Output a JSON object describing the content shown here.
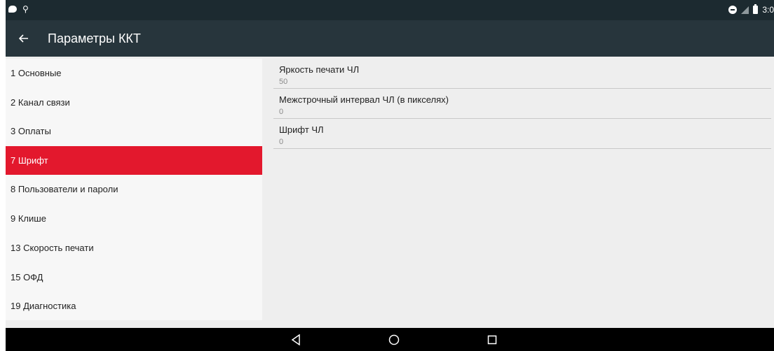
{
  "status_bar": {
    "time": "3:0",
    "icons": [
      "notification-icon",
      "usb-icon",
      "do-not-disturb-icon",
      "no-signal-icon",
      "battery-icon"
    ]
  },
  "toolbar": {
    "back_icon": "arrow-left-icon",
    "title": "Параметры ККТ"
  },
  "menu": {
    "items": [
      {
        "label": "1 Основные"
      },
      {
        "label": "2 Канал связи"
      },
      {
        "label": "3 Оплаты"
      },
      {
        "label": "7 Шрифт"
      },
      {
        "label": "8 Пользователи и пароли"
      },
      {
        "label": "9 Клише"
      },
      {
        "label": "13 Скорость печати"
      },
      {
        "label": "15 ОФД"
      },
      {
        "label": "19 Диагностика"
      }
    ],
    "selected": "7 Шрифт"
  },
  "settings": {
    "items": [
      {
        "title": "Яркость печати ЧЛ",
        "value": "50"
      },
      {
        "title": "Межстрочный интервал ЧЛ (в пикселях)",
        "value": "0"
      },
      {
        "title": "Шрифт ЧЛ",
        "value": "0"
      }
    ]
  },
  "navbar": {
    "icons": [
      "back-triangle-icon",
      "home-circle-icon",
      "recents-square-icon"
    ]
  },
  "colors": {
    "status_bar": "#1c2a30",
    "toolbar": "#27353c",
    "accent": "#e3182d",
    "background": "#eeeeee",
    "menu_background": "#f7f7f7"
  }
}
